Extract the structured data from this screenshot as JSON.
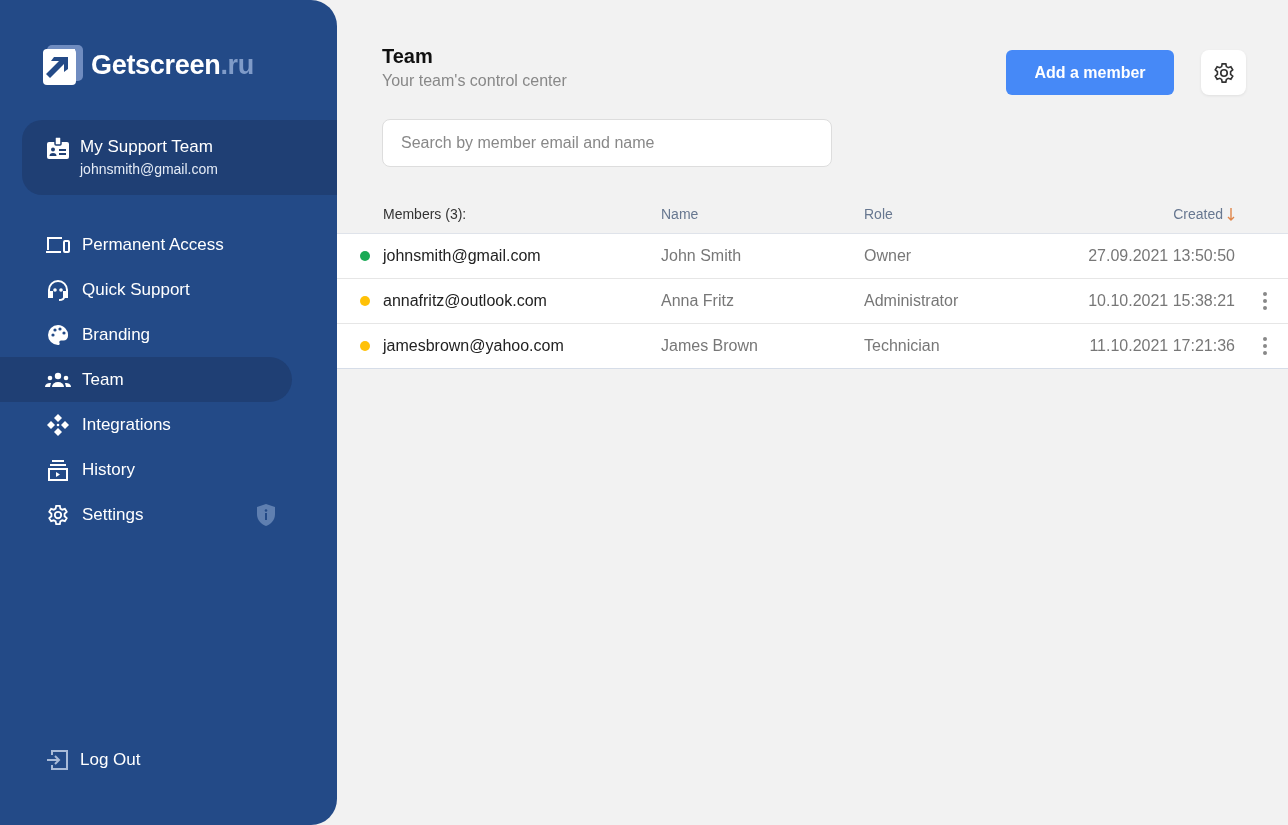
{
  "logo": {
    "name": "Getscreen",
    "suffix": ".ru"
  },
  "workspace": {
    "title": "My Support Team",
    "email": "johnsmith@gmail.com"
  },
  "nav": [
    {
      "kind": "devices",
      "label": "Permanent Access",
      "selected": false,
      "badge": false
    },
    {
      "kind": "headset",
      "label": "Quick Support",
      "selected": false,
      "badge": false
    },
    {
      "kind": "palette",
      "label": "Branding",
      "selected": false,
      "badge": false
    },
    {
      "kind": "team",
      "label": "Team",
      "selected": true,
      "badge": false
    },
    {
      "kind": "integrations",
      "label": "Integrations",
      "selected": false,
      "badge": false
    },
    {
      "kind": "history",
      "label": "History",
      "selected": false,
      "badge": false
    },
    {
      "kind": "settings",
      "label": "Settings",
      "selected": false,
      "badge": true
    }
  ],
  "logout": {
    "label": "Log Out"
  },
  "page": {
    "title": "Team",
    "subtitle": "Your team's control center"
  },
  "add_button": "Add a member",
  "search": {
    "placeholder": "Search by member email and name"
  },
  "table": {
    "columns": [
      {
        "label": "Members (3):",
        "sorted": false
      },
      {
        "label": "Name",
        "sorted": false
      },
      {
        "label": "Role",
        "sorted": false
      },
      {
        "label": "Created",
        "sorted": true
      }
    ],
    "rows": [
      {
        "email": "johnsmith@gmail.com",
        "name": "John Smith",
        "role": "Owner",
        "created": "27.09.2021 13:50:50",
        "color": "#1aaa55",
        "menu": false
      },
      {
        "email": "annafritz@outlook.com",
        "name": "Anna Fritz",
        "role": "Administrator",
        "created": "10.10.2021 15:38:21",
        "color": "#ffc107",
        "menu": true
      },
      {
        "email": "jamesbrown@yahoo.com",
        "name": "James Brown",
        "role": "Technician",
        "created": "11.10.2021 17:21:36",
        "color": "#ffc107",
        "menu": true
      }
    ]
  }
}
